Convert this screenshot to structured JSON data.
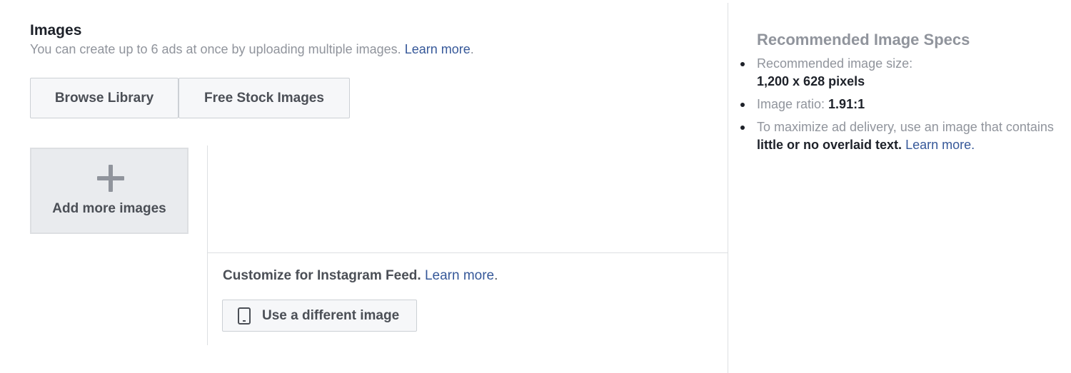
{
  "images_section": {
    "title": "Images",
    "description": "You can create up to 6 ads at once by uploading multiple images.",
    "learn_more": "Learn more",
    "period": "."
  },
  "buttons": {
    "browse_library": "Browse Library",
    "free_stock_images": "Free Stock Images"
  },
  "add_tile": {
    "label": "Add more images",
    "icon": "plus-icon"
  },
  "instagram": {
    "title": "Customize for Instagram Feed.",
    "learn_more": "Learn more",
    "period": ".",
    "button_label": "Use a different image",
    "button_icon": "phone-icon"
  },
  "specs": {
    "title": "Recommended Image Specs",
    "size_label": "Recommended image size:",
    "size_value": "1,200 x 628 pixels",
    "ratio_label": "Image ratio: ",
    "ratio_value": "1.91:1",
    "text_prefix": "To maximize ad delivery, use an image that contains ",
    "text_bold": "little or no overlaid text.",
    "text_learn_more": "Learn more",
    "text_period": "."
  },
  "colors": {
    "link": "#365899",
    "muted": "#90949c",
    "button_text": "#4b4f56",
    "border": "#dddfe2"
  }
}
